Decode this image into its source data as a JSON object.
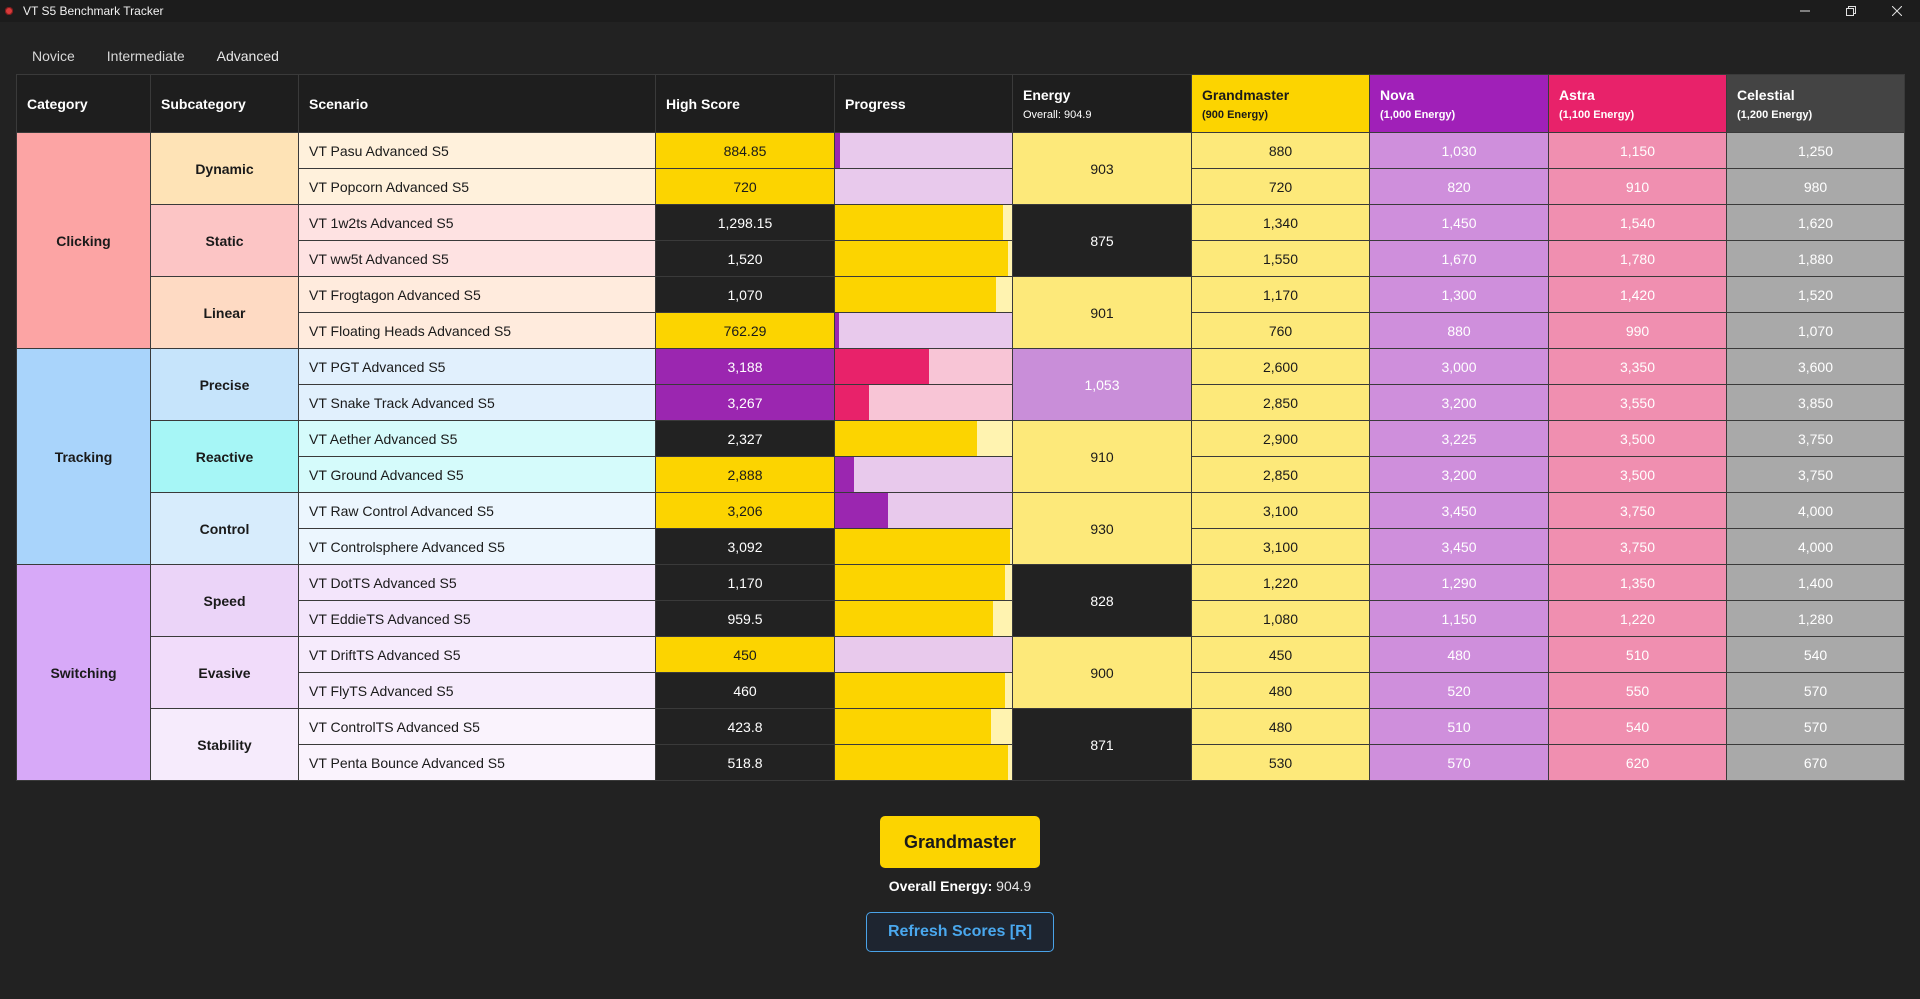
{
  "window": {
    "title": "VT S5 Benchmark Tracker"
  },
  "tabs": [
    "Novice",
    "Intermediate",
    "Advanced"
  ],
  "active_tab": "Advanced",
  "headers": {
    "category": "Category",
    "subcategory": "Subcategory",
    "scenario": "Scenario",
    "high_score": "High Score",
    "progress": "Progress",
    "energy": "Energy",
    "energy_sub": "Overall: 904.9",
    "grandmaster": "Grandmaster",
    "grandmaster_sub": "(900 Energy)",
    "nova": "Nova",
    "nova_sub": "(1,000 Energy)",
    "astra": "Astra",
    "astra_sub": "(1,100 Energy)",
    "celestial": "Celestial",
    "celestial_sub": "(1,200 Energy)"
  },
  "colors": {
    "gold": "#fcd400",
    "gold_light": "#fde97a",
    "purple": "#9b26b0",
    "pink": "#e8226a",
    "lilac_track": "#e8c9ec",
    "pink_track": "#f8c5d6",
    "yellow_track": "#fff3b0",
    "accent_blue": "#4aa3e8"
  },
  "categories": [
    {
      "name": "Clicking",
      "color": "#fca4a4"
    },
    {
      "name": "Tracking",
      "color": "#a9d4fb"
    },
    {
      "name": "Switching",
      "color": "#d7a9f8"
    }
  ],
  "subcategories": [
    {
      "name": "Dynamic",
      "color": "#fee3b6",
      "energy": "903",
      "energy_style": "yellow"
    },
    {
      "name": "Static",
      "color": "#fcc5c5",
      "energy": "875",
      "energy_style": "dark"
    },
    {
      "name": "Linear",
      "color": "#fedac3",
      "energy": "901",
      "energy_style": "yellow"
    },
    {
      "name": "Precise",
      "color": "#c6e4fb",
      "energy": "1,053",
      "energy_style": "lilac"
    },
    {
      "name": "Reactive",
      "color": "#a6f6f6",
      "energy": "910",
      "energy_style": "yellow"
    },
    {
      "name": "Control",
      "color": "#d7ecfc",
      "energy": "930",
      "energy_style": "yellow"
    },
    {
      "name": "Speed",
      "color": "#ebd4f8",
      "energy": "828",
      "energy_style": "dark"
    },
    {
      "name": "Evasive",
      "color": "#f1dcfa",
      "energy": "900",
      "energy_style": "yellow"
    },
    {
      "name": "Stability",
      "color": "#f6ebfc",
      "energy": "871",
      "energy_style": "dark"
    }
  ],
  "rows": [
    {
      "scenario": "VT Pasu Advanced S5",
      "row_color": "#fff1dc",
      "high_score": "884.85",
      "hs_style": "gold",
      "progress": 0.03,
      "bar_color": "#9b26b0",
      "track_color": "#e8c9ec",
      "gm": "880",
      "nova": "1,030",
      "astra": "1,150",
      "celestial": "1,250"
    },
    {
      "scenario": "VT Popcorn Advanced S5",
      "row_color": "#fff1dc",
      "high_score": "720",
      "hs_style": "gold",
      "progress": 0.0,
      "bar_color": "#9b26b0",
      "track_color": "#e8c9ec",
      "gm": "720",
      "nova": "820",
      "astra": "910",
      "celestial": "980"
    },
    {
      "scenario": "VT 1w2ts Advanced S5",
      "row_color": "#fee2e2",
      "high_score": "1,298.15",
      "hs_style": "dark",
      "progress": 0.95,
      "bar_color": "#fcd400",
      "track_color": "#fff3b0",
      "gm": "1,340",
      "nova": "1,450",
      "astra": "1,540",
      "celestial": "1,620"
    },
    {
      "scenario": "VT ww5t Advanced S5",
      "row_color": "#fee2e2",
      "high_score": "1,520",
      "hs_style": "dark",
      "progress": 0.98,
      "bar_color": "#fcd400",
      "track_color": "#fff3b0",
      "gm": "1,550",
      "nova": "1,670",
      "astra": "1,780",
      "celestial": "1,880"
    },
    {
      "scenario": "VT Frogtagon Advanced S5",
      "row_color": "#ffebdd",
      "high_score": "1,070",
      "hs_style": "dark",
      "progress": 0.91,
      "bar_color": "#fcd400",
      "track_color": "#fff3b0",
      "gm": "1,170",
      "nova": "1,300",
      "astra": "1,420",
      "celestial": "1,520"
    },
    {
      "scenario": "VT Floating Heads Advanced S5",
      "row_color": "#ffebdd",
      "high_score": "762.29",
      "hs_style": "gold",
      "progress": 0.02,
      "bar_color": "#9b26b0",
      "track_color": "#e8c9ec",
      "gm": "760",
      "nova": "880",
      "astra": "990",
      "celestial": "1,070"
    },
    {
      "scenario": "VT PGT Advanced S5",
      "row_color": "#e1f0fd",
      "high_score": "3,188",
      "hs_style": "purple",
      "progress": 0.53,
      "bar_color": "#e8226a",
      "track_color": "#f8c5d6",
      "gm": "2,600",
      "nova": "3,000",
      "astra": "3,350",
      "celestial": "3,600"
    },
    {
      "scenario": "VT Snake Track Advanced S5",
      "row_color": "#e1f0fd",
      "high_score": "3,267",
      "hs_style": "purple",
      "progress": 0.19,
      "bar_color": "#e8226a",
      "track_color": "#f8c5d6",
      "gm": "2,850",
      "nova": "3,200",
      "astra": "3,550",
      "celestial": "3,850"
    },
    {
      "scenario": "VT Aether Advanced S5",
      "row_color": "#d5fbfb",
      "high_score": "2,327",
      "hs_style": "dark",
      "progress": 0.8,
      "bar_color": "#fcd400",
      "track_color": "#fff3b0",
      "gm": "2,900",
      "nova": "3,225",
      "astra": "3,500",
      "celestial": "3,750"
    },
    {
      "scenario": "VT Ground Advanced S5",
      "row_color": "#d5fbfb",
      "high_score": "2,888",
      "hs_style": "gold",
      "progress": 0.11,
      "bar_color": "#9b26b0",
      "track_color": "#e8c9ec",
      "gm": "2,850",
      "nova": "3,200",
      "astra": "3,500",
      "celestial": "3,750"
    },
    {
      "scenario": "VT Raw Control Advanced S5",
      "row_color": "#ecf6fe",
      "high_score": "3,206",
      "hs_style": "gold",
      "progress": 0.3,
      "bar_color": "#9b26b0",
      "track_color": "#e8c9ec",
      "gm": "3,100",
      "nova": "3,450",
      "astra": "3,750",
      "celestial": "4,000"
    },
    {
      "scenario": "VT Controlsphere Advanced S5",
      "row_color": "#ecf6fe",
      "high_score": "3,092",
      "hs_style": "dark",
      "progress": 0.99,
      "bar_color": "#fcd400",
      "track_color": "#fff3b0",
      "gm": "3,100",
      "nova": "3,450",
      "astra": "3,750",
      "celestial": "4,000"
    },
    {
      "scenario": "VT DotTS Advanced S5",
      "row_color": "#f3e5fb",
      "high_score": "1,170",
      "hs_style": "dark",
      "progress": 0.96,
      "bar_color": "#fcd400",
      "track_color": "#fff3b0",
      "gm": "1,220",
      "nova": "1,290",
      "astra": "1,350",
      "celestial": "1,400"
    },
    {
      "scenario": "VT EddieTS Advanced S5",
      "row_color": "#f3e5fb",
      "high_score": "959.5",
      "hs_style": "dark",
      "progress": 0.89,
      "bar_color": "#fcd400",
      "track_color": "#fff3b0",
      "gm": "1,080",
      "nova": "1,150",
      "astra": "1,220",
      "celestial": "1,280"
    },
    {
      "scenario": "VT DriftTS Advanced S5",
      "row_color": "#f6ebfc",
      "high_score": "450",
      "hs_style": "gold",
      "progress": 0.0,
      "bar_color": "#9b26b0",
      "track_color": "#e8c9ec",
      "gm": "450",
      "nova": "480",
      "astra": "510",
      "celestial": "540"
    },
    {
      "scenario": "VT FlyTS Advanced S5",
      "row_color": "#f6ebfc",
      "high_score": "460",
      "hs_style": "dark",
      "progress": 0.96,
      "bar_color": "#fcd400",
      "track_color": "#fff3b0",
      "gm": "480",
      "nova": "520",
      "astra": "550",
      "celestial": "570"
    },
    {
      "scenario": "VT ControlTS Advanced S5",
      "row_color": "#faf3fd",
      "high_score": "423.8",
      "hs_style": "dark",
      "progress": 0.88,
      "bar_color": "#fcd400",
      "track_color": "#fff3b0",
      "gm": "480",
      "nova": "510",
      "astra": "540",
      "celestial": "570"
    },
    {
      "scenario": "VT Penta Bounce Advanced S5",
      "row_color": "#faf3fd",
      "high_score": "518.8",
      "hs_style": "dark",
      "progress": 0.98,
      "bar_color": "#fcd400",
      "track_color": "#fff3b0",
      "gm": "530",
      "nova": "570",
      "astra": "620",
      "celestial": "670"
    }
  ],
  "rank": {
    "label": "Grandmaster"
  },
  "overall": {
    "label": "Overall Energy:",
    "value": "904.9"
  },
  "refresh_button": {
    "label": "Refresh Scores [R]"
  }
}
